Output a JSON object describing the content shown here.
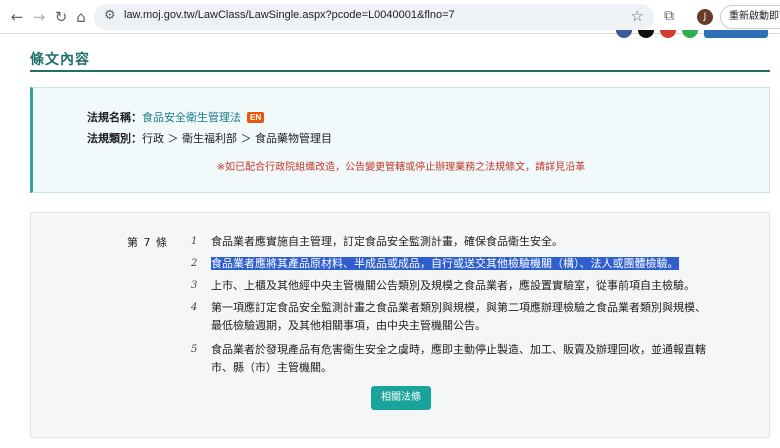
{
  "browser": {
    "url": "law.moj.gov.tw/LawClass/LawSingle.aspx?pcode=L0040001&flno=7",
    "profile_initial": "J",
    "relaunch_label": "重新啟動即可更新"
  },
  "page": {
    "heading": "條文內容",
    "info": {
      "law_name_label": "法規名稱：",
      "law_name": "食品安全衛生管理法",
      "en_badge": "EN",
      "category_label": "法規類別：",
      "category_path": "行政 ＞ 衛生福利部 ＞ 食品藥物管理目",
      "notice": "※如已配合行政院組織改造，公告變更管轄或停止辦理業務之法規條文，請詳見沿革"
    },
    "article": {
      "number_label": "第 7 條",
      "paragraphs": [
        {
          "num": "1",
          "text": "食品業者應實施自主管理，訂定食品安全監測計畫，確保食品衛生安全。"
        },
        {
          "num": "2",
          "text": "食品業者應將其產品原材料、半成品或成品，自行或送交其他檢驗機關（構）、法人或團體檢驗。"
        },
        {
          "num": "3",
          "text": "上市、上櫃及其他經中央主管機關公告類別及規模之食品業者，應設置實驗室，從事前項自主檢驗。"
        },
        {
          "num": "4",
          "text": "第一項應訂定食品安全監測計畫之食品業者類別與規模，與第二項應辦理檢驗之食品業者類別與規模、最低檢驗週期，及其他相關事項，由中央主管機關公告。"
        },
        {
          "num": "5",
          "text": "食品業者於發現產品有危害衛生安全之虞時，應即主動停止製造、加工、販賣及辦理回收，並通報直轄市、縣（市）主管機關。"
        }
      ],
      "related_button": "相關法條"
    }
  },
  "colors": {
    "accent": "#1f6f6a",
    "button": "#1aa39a",
    "notice": "#c0392b",
    "highlight": "#2f5fce"
  }
}
